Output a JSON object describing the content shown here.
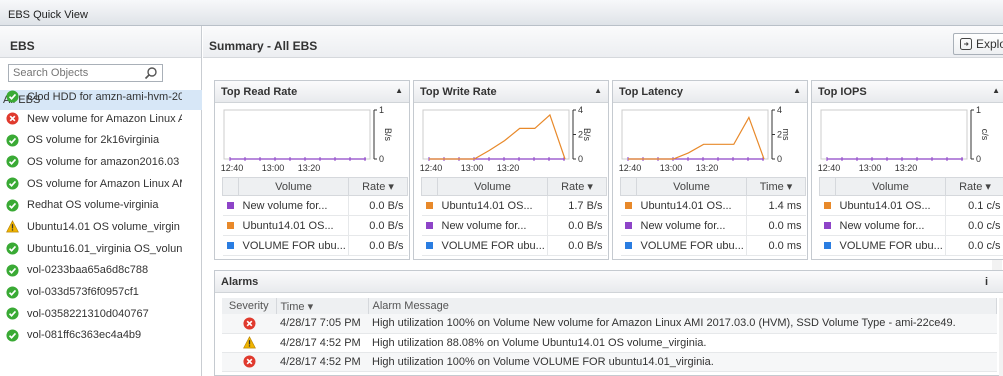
{
  "window": {
    "title": "EBS Quick View"
  },
  "sidebar": {
    "title": "EBS",
    "search_placeholder": "Search Objects",
    "all_label": "All EBS",
    "items": [
      {
        "label": "Clod HDD for amzn-ami-hvm-20",
        "status": "ok"
      },
      {
        "label": "New volume for Amazon Linux A",
        "status": "error"
      },
      {
        "label": "OS volume for 2k16virginia",
        "status": "ok"
      },
      {
        "label": "OS volume for amazon2016.03",
        "status": "ok"
      },
      {
        "label": "OS volume for Amazon Linux AM",
        "status": "ok"
      },
      {
        "label": "Redhat OS volume-virginia",
        "status": "ok"
      },
      {
        "label": "Ubuntu14.01 OS volume_virgin",
        "status": "warning"
      },
      {
        "label": "Ubuntu16.01_virginia OS_volun",
        "status": "ok"
      },
      {
        "label": "vol-0233baa65a6d8c788",
        "status": "ok"
      },
      {
        "label": "vol-033d573f6f0957cf1",
        "status": "ok"
      },
      {
        "label": "vol-0358221310d040767",
        "status": "ok"
      },
      {
        "label": "vol-081ff6c363ec4a4b9",
        "status": "ok"
      },
      {
        "label": "VOLUME FOR ubuntu14.01_virg",
        "status": "error"
      }
    ]
  },
  "main": {
    "title": "Summary - All EBS",
    "explore_label": "Explo"
  },
  "colors": {
    "purple": "#8e44c8",
    "orange": "#e8892a",
    "blue": "#2a7de1",
    "ok": "#3aaa35",
    "error": "#e03a2e",
    "warning": "#f0b400"
  },
  "chart_data": [
    {
      "type": "line",
      "title": "Top Read Rate",
      "unit": "B/s",
      "x": [
        "12:40",
        "13:00",
        "13:20"
      ],
      "ylim": [
        0,
        1
      ],
      "yticks": [
        "1",
        "0"
      ],
      "series": [
        {
          "color": "#8e44c8",
          "values": [
            0,
            0,
            0,
            0,
            0,
            0,
            0,
            0,
            0
          ]
        }
      ],
      "table": {
        "col1": "Volume",
        "col2": "Rate ▾",
        "rows": [
          {
            "name": "New volume for...",
            "value": "0.0 B/s",
            "color": "#8e44c8"
          },
          {
            "name": "Ubuntu14.01 OS...",
            "value": "0.0 B/s",
            "color": "#e8892a"
          },
          {
            "name": "VOLUME FOR ubu...",
            "value": "0.0 B/s",
            "color": "#2a7de1"
          }
        ]
      }
    },
    {
      "type": "line",
      "title": "Top Write Rate",
      "unit": "B/s",
      "x": [
        "12:40",
        "13:00",
        "13:20"
      ],
      "ylim": [
        0,
        4
      ],
      "yticks": [
        "4",
        "2",
        "0"
      ],
      "series": [
        {
          "color": "#8e44c8",
          "values": [
            0,
            0,
            0,
            0,
            0,
            0,
            0,
            0,
            0
          ]
        },
        {
          "color": "#e8892a",
          "values": [
            0,
            0,
            0,
            0,
            0.7,
            1.5,
            2.5,
            2.5,
            3.6,
            0
          ]
        }
      ],
      "table": {
        "col1": "Volume",
        "col2": "Rate ▾",
        "rows": [
          {
            "name": "Ubuntu14.01 OS...",
            "value": "1.7 B/s",
            "color": "#e8892a"
          },
          {
            "name": "New volume for...",
            "value": "0.0 B/s",
            "color": "#8e44c8"
          },
          {
            "name": "VOLUME FOR ubu...",
            "value": "0.0 B/s",
            "color": "#2a7de1"
          }
        ]
      }
    },
    {
      "type": "line",
      "title": "Top Latency",
      "unit": "ms",
      "x": [
        "12:40",
        "13:00",
        "13:20"
      ],
      "ylim": [
        0,
        4
      ],
      "yticks": [
        "4",
        "2",
        "0"
      ],
      "series": [
        {
          "color": "#8e44c8",
          "values": [
            0,
            0,
            0,
            0,
            0,
            0,
            0,
            0,
            0
          ]
        },
        {
          "color": "#e8892a",
          "values": [
            0,
            0,
            0,
            0,
            0.5,
            1.2,
            1.2,
            1.2,
            3.4,
            0
          ]
        }
      ],
      "table": {
        "col1": "Volume",
        "col2": "Time ▾",
        "rows": [
          {
            "name": "Ubuntu14.01 OS...",
            "value": "1.4 ms",
            "color": "#e8892a"
          },
          {
            "name": "New volume for...",
            "value": "0.0 ms",
            "color": "#8e44c8"
          },
          {
            "name": "VOLUME FOR ubu...",
            "value": "0.0 ms",
            "color": "#2a7de1"
          }
        ]
      }
    },
    {
      "type": "line",
      "title": "Top IOPS",
      "unit": "c/s",
      "x": [
        "12:40",
        "13:00",
        "13:20"
      ],
      "ylim": [
        0,
        1
      ],
      "yticks": [
        "1",
        "0"
      ],
      "series": [
        {
          "color": "#8e44c8",
          "values": [
            0,
            0,
            0,
            0,
            0,
            0,
            0,
            0,
            0
          ]
        }
      ],
      "table": {
        "col1": "Volume",
        "col2": "Rate ▾",
        "rows": [
          {
            "name": "Ubuntu14.01 OS...",
            "value": "0.1 c/s",
            "color": "#e8892a"
          },
          {
            "name": "New volume for...",
            "value": "0.0 c/s",
            "color": "#8e44c8"
          },
          {
            "name": "VOLUME FOR ubu...",
            "value": "0.0 c/s",
            "color": "#2a7de1"
          }
        ]
      }
    }
  ],
  "alarms": {
    "title": "Alarms",
    "info": "i",
    "headers": {
      "severity": "Severity",
      "time": "Time ▾",
      "message": "Alarm Message"
    },
    "rows": [
      {
        "severity": "error",
        "time": "4/28/17 7:05 PM",
        "message": "High utilization 100% on Volume New volume for Amazon Linux AMI 2017.03.0 (HVM), SSD Volume Type - ami-22ce49."
      },
      {
        "severity": "warning",
        "time": "4/28/17 4:52 PM",
        "message": "High utilization 88.08% on Volume Ubuntu14.01 OS volume_virginia."
      },
      {
        "severity": "error",
        "time": "4/28/17 4:52 PM",
        "message": "High utilization 100% on Volume VOLUME FOR ubuntu14.01_virginia."
      }
    ]
  }
}
